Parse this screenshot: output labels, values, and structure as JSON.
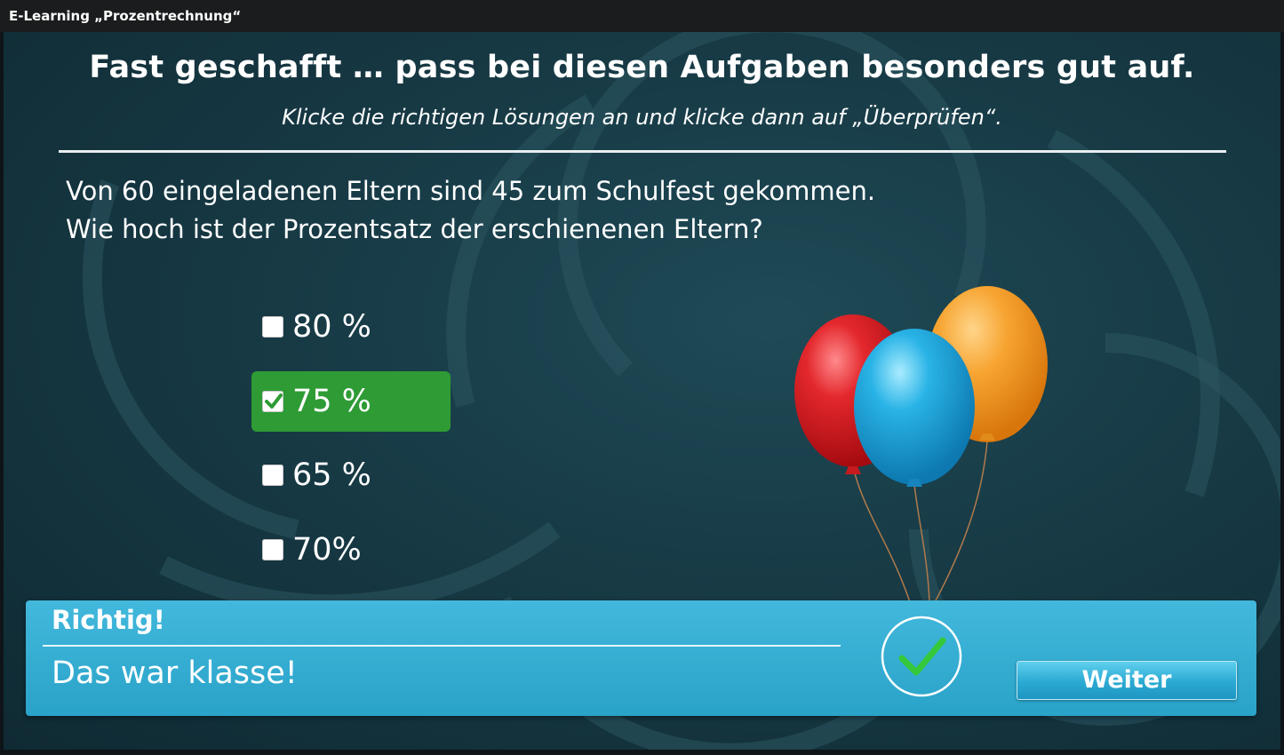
{
  "window": {
    "title": "E-Learning „Prozentrechnung“"
  },
  "slide": {
    "heading": "Fast geschafft … pass bei diesen Aufgaben besonders gut auf.",
    "instruction": "Klicke die richtigen Lösungen an und klicke dann auf „Überprüfen“.",
    "question_line1": "Von 60 eingeladenen Eltern sind 45 zum Schulfest gekommen.",
    "question_line2": "Wie hoch ist der Prozentsatz der erschienenen Eltern?",
    "options": [
      {
        "label": "80 %",
        "checked": false
      },
      {
        "label": "75 %",
        "checked": true
      },
      {
        "label": "65 %",
        "checked": false
      },
      {
        "label": "70%",
        "checked": false
      }
    ]
  },
  "feedback": {
    "title": "Richtig!",
    "message": "Das war klasse!",
    "button_label": "Weiter",
    "icon": "checkmark-circle-icon"
  },
  "colors": {
    "selected_option": "#2e9b35",
    "feedback_panel": "#2aa3c9",
    "check_green": "#35c83a",
    "balloon_red": "#d8141a",
    "balloon_blue": "#1aa3d9",
    "balloon_orange": "#f39a21"
  }
}
